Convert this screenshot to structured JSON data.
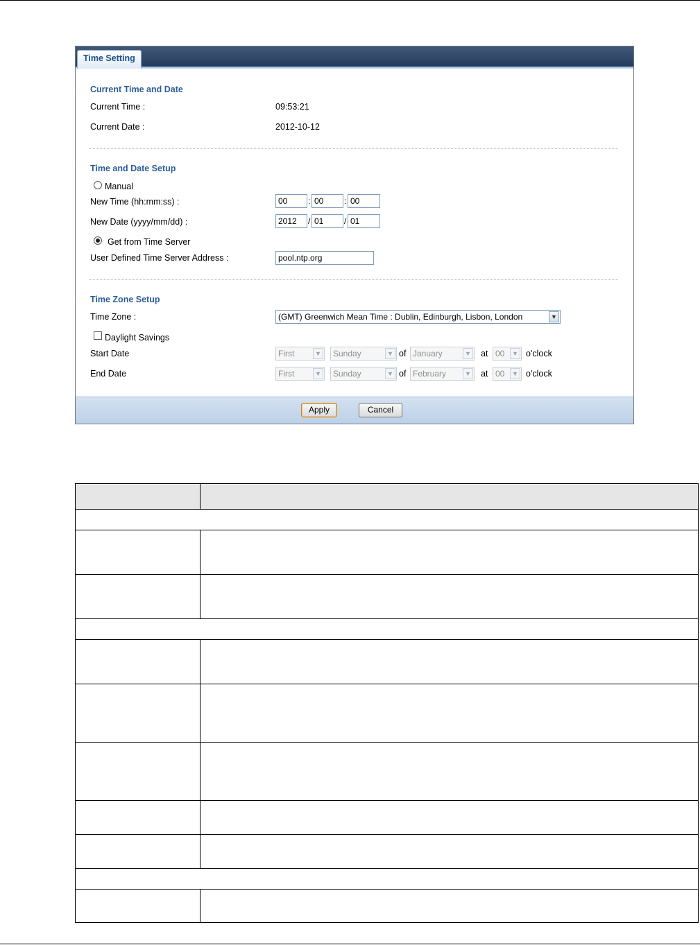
{
  "tab": {
    "label": "Time Setting"
  },
  "current": {
    "heading": "Current Time and Date",
    "time_label": "Current Time :",
    "time_value": "09:53:21",
    "date_label": "Current Date :",
    "date_value": "2012-10-12"
  },
  "setup": {
    "heading": "Time and Date Setup",
    "manual_label": "Manual",
    "new_time_label": "New Time (hh:mm:ss) :",
    "hh": "00",
    "mm": "00",
    "ss": "00",
    "time_sep": ":",
    "new_date_label": "New Date (yyyy/mm/dd) :",
    "yyyy": "2012",
    "month": "01",
    "day": "01",
    "date_sep": "/",
    "server_label": "Get from Time Server",
    "server_addr_label": "User Defined Time Server Address :",
    "server_addr": "pool.ntp.org",
    "selected_mode": "server"
  },
  "zone": {
    "heading": "Time Zone Setup",
    "tz_label": "Time Zone :",
    "tz_value": "(GMT) Greenwich Mean Time : Dublin, Edinburgh, Lisbon, London",
    "dst_label": "Daylight Savings",
    "dst_checked": false,
    "start_label": "Start Date",
    "end_label": "End Date",
    "start": {
      "week": "First",
      "day": "Sunday",
      "month": "January",
      "hour": "00"
    },
    "end": {
      "week": "First",
      "day": "Sunday",
      "month": "February",
      "hour": "00"
    },
    "of_text": "of",
    "at_text": "at",
    "oclock_text": "o'clock"
  },
  "buttons": {
    "apply": "Apply",
    "cancel": "Cancel"
  },
  "icons": {
    "dropdown": "chevron-down-icon"
  },
  "colors": {
    "heading": "#2a5d9a",
    "tabbar": "#2f4767",
    "footer": "#c8d9ec"
  }
}
